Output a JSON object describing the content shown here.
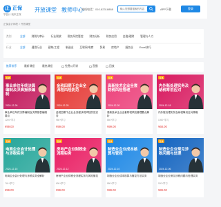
{
  "header": {
    "logo_mark": "正",
    "logo_name": "正保",
    "logo_tagline": "会计网校",
    "logo_sub": "学会计 就来正保",
    "nav": [
      "开放课堂",
      "教师中心"
    ],
    "hotline": "热线电话：010-82318888",
    "search_placeholder": "输入您想要搜索的内容",
    "app_download": "APP下载",
    "login": "登录"
  },
  "breadcrumb": "正保会计网校 > 开放课堂",
  "filters": {
    "row1": {
      "label": "类别",
      "options": [
        "全部",
        "财税与审计",
        "行业税收",
        "税务风险管控",
        "财务分析",
        "财务应用",
        "金融/理财",
        "管理与人力"
      ],
      "active": 0
    },
    "row2": {
      "label": "行业",
      "options": [
        "全部",
        "通用行业",
        "建筑/工程",
        "制造业",
        "互联网/电商",
        "贸易",
        "房地产",
        "服务业",
        "Excel技巧"
      ],
      "active": 0
    }
  },
  "sortbar": {
    "options": [
      "推荐排序",
      "最新课程",
      "最热课程"
    ],
    "active": 0,
    "checks": [
      "免费公开课",
      "直播",
      "回放"
    ]
  },
  "cards": [
    {
      "tag": "直播",
      "thumb_title": "事业单位年终决算编制及决算报表编制",
      "date": "2024-12-26",
      "title": "事业单位年终决算编制及决算报表编制要点",
      "sub": "1200+学习",
      "price": "¥99.00",
      "color": "#c2185b"
    },
    {
      "tag": "直播",
      "thumb_title": "金税四期下企业全流程风险防范",
      "date": "2024-12-25",
      "title": "金税四期下企业全流程涉税风险防范实务",
      "sub": "980+学习",
      "price": "¥99.00",
      "color": "#e53935"
    },
    {
      "tag": "直播",
      "thumb_title": "高新技术企业全套财税风险管理",
      "date": "2024-12-20",
      "title": "高新技术企业全套财税风险管理要点解析",
      "sub": "860+学习",
      "price": "¥99.00",
      "color": "#ec407a"
    },
    {
      "tag": "直播",
      "thumb_title": "内外账处理实务及纳税筹划应对",
      "date": "2024-12-18",
      "title": "内外账处理实务及纳税筹划应对策略",
      "sub": "1050+学习",
      "price": "¥68.00",
      "color": "#d81b60"
    },
    {
      "tag": "直播",
      "thumb_title": "电商企业会计处理与涉税实务",
      "date": "2024-12-15",
      "title": "电商企业会计处理与涉税实务全解析",
      "sub": "740+学习",
      "price": "¥99.00",
      "color": "#26a69a"
    },
    {
      "tag": "直播",
      "thumb_title": "房地产企业财税全流程实务",
      "date": "2024-12-12",
      "title": "房地产企业财税全流程实务与风险管控",
      "sub": "690+学习",
      "price": "¥99.00",
      "color": "#e91e63"
    },
    {
      "tag": "直播",
      "thumb_title": "制造业企业成本核算与管控",
      "date": "2024-12-10",
      "title": "制造业企业成本核算与管控方法实务",
      "sub": "880+学习",
      "price": "¥99.00",
      "color": "#1e88e5"
    },
    {
      "tag": "直播",
      "thumb_title": "制造业企业常见涉税问题与处理",
      "date": "2024-12-06",
      "title": "制造业企业常见涉税问题与处理实务",
      "sub": "920+学习",
      "price": "¥99.00",
      "color": "#1565c0"
    }
  ]
}
